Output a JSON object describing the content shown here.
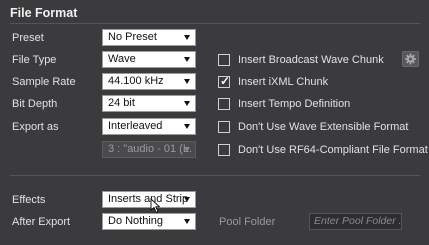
{
  "section": {
    "title": "File Format"
  },
  "form": {
    "preset": {
      "label": "Preset",
      "value": "No Preset"
    },
    "file_type": {
      "label": "File Type",
      "value": "Wave"
    },
    "sample_rate": {
      "label": "Sample Rate",
      "value": "44.100 kHz"
    },
    "bit_depth": {
      "label": "Bit Depth",
      "value": "24 bit"
    },
    "export_as": {
      "label": "Export as",
      "value": "Interleaved"
    },
    "channel_select": {
      "value": "3 : \"audio - 01 (L."
    }
  },
  "options": [
    {
      "label": "Insert Broadcast Wave Chunk",
      "checked": false
    },
    {
      "label": "Insert iXML Chunk",
      "checked": true
    },
    {
      "label": "Insert Tempo Definition",
      "checked": false
    },
    {
      "label": "Don't Use Wave Extensible Format",
      "checked": false
    },
    {
      "label": "Don't Use RF64-Compliant File Format",
      "checked": false
    }
  ],
  "effects": {
    "label": "Effects",
    "value": "Inserts and Strip"
  },
  "after_export": {
    "label": "After Export",
    "value": "Do Nothing"
  },
  "pool_folder": {
    "label": "Pool Folder",
    "placeholder": "Enter Pool Folder ."
  },
  "icons": {
    "settings": "gear-icon",
    "cursor": "mouse-pointer-icon",
    "check": "checkmark-icon"
  }
}
